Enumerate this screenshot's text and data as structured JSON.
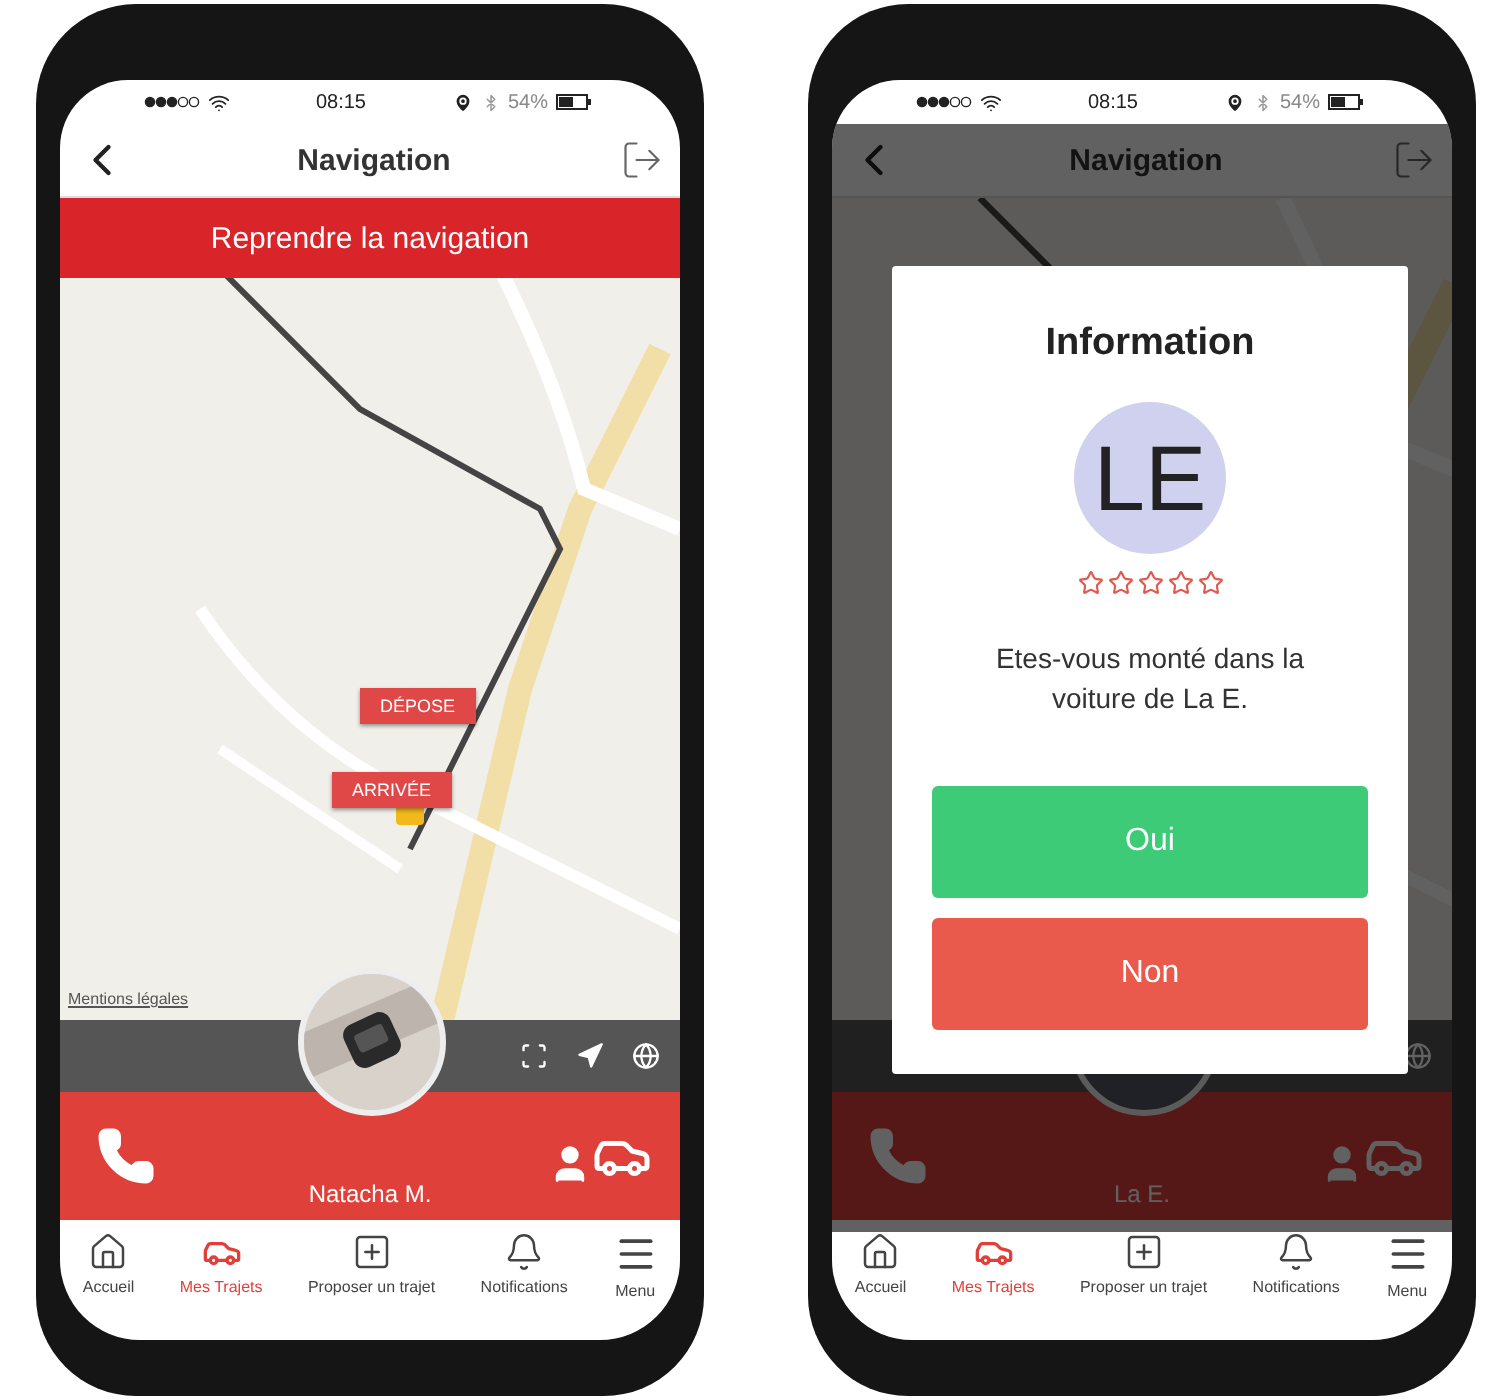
{
  "phones": [
    {
      "status_bar": {
        "time": "08:15",
        "battery": "54%"
      },
      "header": {
        "title": "Navigation"
      },
      "banner": "Reprendre la navigation",
      "map": {
        "kind": "picture",
        "markers": [
          "DÉPOSE",
          "ARRIVÉE"
        ],
        "legal_link": "Mentions légales"
      },
      "driver": {
        "name": "Natacha M."
      },
      "tabs": [
        {
          "label": "Accueil",
          "kind": "home",
          "selected": false
        },
        {
          "label": "Mes Trajets",
          "kind": "car",
          "selected": true
        },
        {
          "label": "Proposer un trajet",
          "kind": "plus",
          "selected": false
        },
        {
          "label": "Notifications",
          "kind": "bell",
          "selected": false
        },
        {
          "label": "Menu",
          "kind": "menu",
          "selected": false
        }
      ]
    },
    {
      "status_bar": {
        "time": "08:15",
        "battery": "54%"
      },
      "header": {
        "title": "Navigation"
      },
      "driver": {
        "name": "La E.",
        "kind": "initials"
      },
      "dialog": {
        "title": "Information",
        "initials": "LE",
        "stars": 0,
        "message": "Etes-vous monté dans la voiture de La E.",
        "buttons": [
          {
            "label": "Oui",
            "kind": "confirm"
          },
          {
            "label": "Non",
            "kind": "cancel"
          }
        ]
      },
      "tabs": [
        {
          "label": "Accueil",
          "kind": "home",
          "selected": false
        },
        {
          "label": "Mes Trajets",
          "kind": "car",
          "selected": true
        },
        {
          "label": "Proposer un trajet",
          "kind": "plus",
          "selected": false
        },
        {
          "label": "Notifications",
          "kind": "bell",
          "selected": false
        },
        {
          "label": "Menu",
          "kind": "menu",
          "selected": false
        }
      ]
    }
  ]
}
